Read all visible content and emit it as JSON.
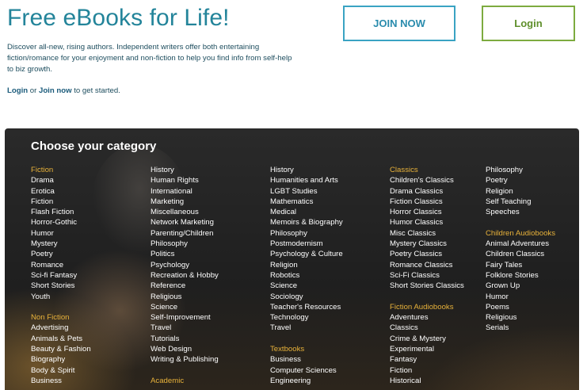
{
  "header": {
    "title": "Free eBooks for Life!",
    "description": "Discover all-new, rising authors. Independent writers offer both entertaining fiction/romance for your enjoyment and non-fiction to help you find info from self-help to biz growth.",
    "cta_login": "Login",
    "cta_or": " or ",
    "cta_join": "Join now",
    "cta_rest": " to get started."
  },
  "buttons": {
    "join": "JOIN NOW",
    "login": "Login"
  },
  "colors": {
    "title": "#23849a",
    "join_border": "#3aa3c3",
    "login_border": "#7dab3f",
    "heading": "#e8b23a"
  },
  "panel": {
    "title": "Choose your category",
    "col1": {
      "fiction_heading": "Fiction",
      "fiction": [
        "Drama",
        "Erotica",
        "Fiction",
        "Flash Fiction",
        "Horror-Gothic",
        "Humor",
        "Mystery",
        "Poetry",
        "Romance",
        "Sci-fi Fantasy",
        "Short Stories",
        "Youth"
      ],
      "nonfiction_heading": "Non Fiction",
      "nonfiction": [
        "Advertising",
        "Animals & Pets",
        "Beauty & Fashion",
        "Biography",
        "Body & Spirit",
        "Business"
      ]
    },
    "col2": {
      "items": [
        "History",
        "Human Rights",
        "International",
        "Marketing",
        "Miscellaneous",
        "Network Marketing",
        "Parenting/Children",
        "Philosophy",
        "Politics",
        "Psychology",
        "Recreation & Hobby",
        "Reference",
        "Religious",
        "Science",
        "Self-Improvement",
        "Travel",
        "Tutorials",
        "Web Design",
        "Writing & Publishing"
      ],
      "academic_heading": "Academic"
    },
    "col3": {
      "items": [
        "History",
        "Humanities and Arts",
        "LGBT Studies",
        "Mathematics",
        "Medical",
        "Memoirs & Biography",
        "Philosophy",
        "Postmodernism",
        "Psychology & Culture",
        "Religion",
        "Robotics",
        "Science",
        "Sociology",
        "Teacher's Resources",
        "Technology",
        "Travel"
      ],
      "textbooks_heading": "Textbooks",
      "textbooks": [
        "Business",
        "Computer Sciences",
        "Engineering"
      ]
    },
    "col4": {
      "classics_heading": "Classics",
      "classics": [
        "Children's Classics",
        "Drama Classics",
        "Fiction Classics",
        "Horror Classics",
        "Humor Classics",
        "Misc Classics",
        "Mystery Classics",
        "Poetry Classics",
        "Romance Classics",
        "Sci-Fi Classics",
        "Short Stories Classics"
      ],
      "fiction_audio_heading": "Fiction Audiobooks",
      "fiction_audio": [
        "Adventures",
        "Classics",
        "Crime & Mystery",
        "Experimental",
        "Fantasy",
        "Fiction",
        "Historical"
      ]
    },
    "col5": {
      "items": [
        "Philosophy",
        "Poetry",
        "Religion",
        "Self Teaching",
        "Speeches"
      ],
      "children_audio_heading": "Children Audiobooks",
      "children_audio": [
        "Animal Adventures",
        "Children Classics",
        "Fairy Tales",
        "Folklore Stories",
        "Grown Up",
        "Humor",
        "Poems",
        "Religious",
        "Serials"
      ]
    }
  }
}
